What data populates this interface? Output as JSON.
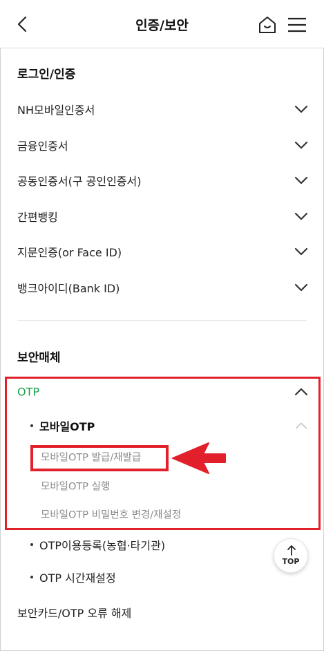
{
  "header": {
    "title": "인증/보안",
    "back_icon": "chevron-left-icon",
    "home_icon": "home-icon",
    "menu_icon": "hamburger-menu-icon"
  },
  "login_section": {
    "title": "로그인/인증",
    "items": [
      {
        "label": "NH모바일인증서"
      },
      {
        "label": "금융인증서"
      },
      {
        "label": "공동인증서(구 공인인증서)"
      },
      {
        "label": "간편뱅킹"
      },
      {
        "label": "지문인증(or Face ID)"
      },
      {
        "label": "뱅크아이디(Bank ID)"
      }
    ]
  },
  "security_section": {
    "title": "보안매체",
    "otp": {
      "label": "OTP",
      "mobile_otp": {
        "label": "모바일OTP",
        "items": [
          {
            "label": "모바일OTP 발급/재발급"
          },
          {
            "label": "모바일OTP 실행"
          },
          {
            "label": "모바일OTP 비밀번호 변경/재설정"
          }
        ]
      },
      "sub_items": [
        {
          "label": "OTP이용등록(농협·타기관)"
        },
        {
          "label": "OTP 시간재설정"
        }
      ]
    },
    "card_item": {
      "label": "보안카드/OTP 오류 해제"
    }
  },
  "top_button": {
    "label": "TOP"
  },
  "colors": {
    "highlight": "#e2202c",
    "otp_green": "#19a04a",
    "muted_text": "#8a8a8a"
  }
}
